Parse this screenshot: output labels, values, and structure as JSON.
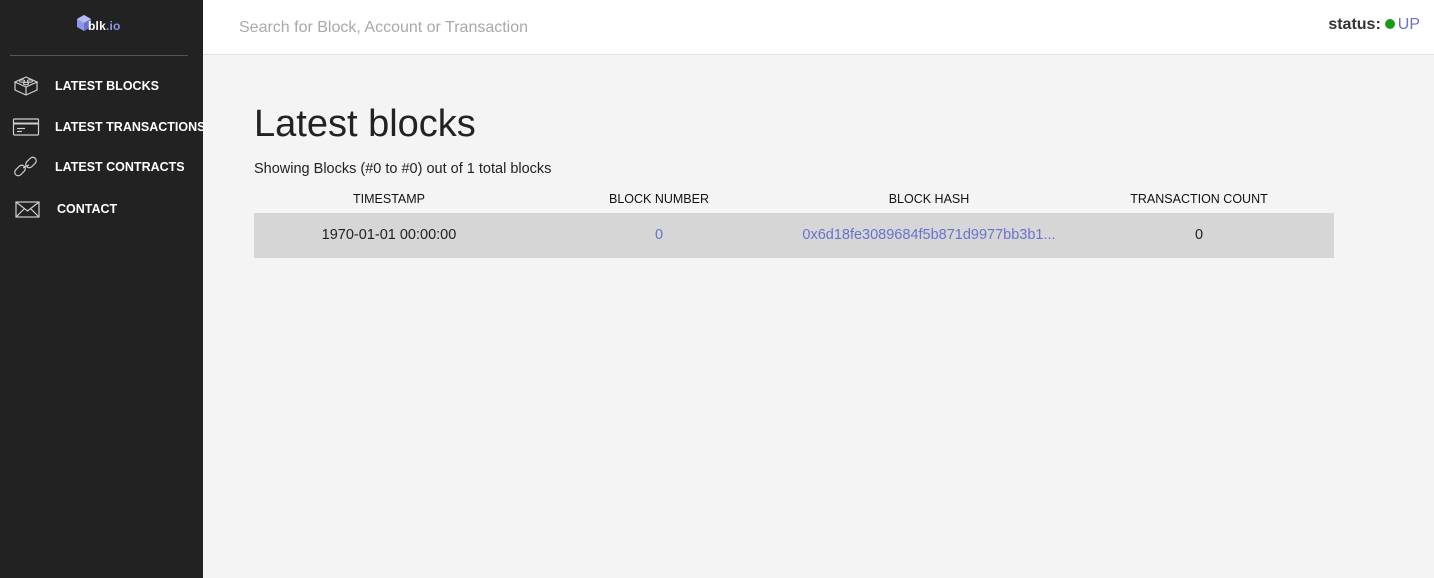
{
  "app": {
    "logo_prefix": "blk",
    "logo_suffix": ".io"
  },
  "sidebar": {
    "items": [
      {
        "label": "LATEST BLOCKS",
        "icon": "blocks-icon"
      },
      {
        "label": "LATEST TRANSACTIONS",
        "icon": "card-icon"
      },
      {
        "label": "LATEST CONTRACTS",
        "icon": "link-icon"
      },
      {
        "label": "CONTACT",
        "icon": "envelope-icon"
      }
    ]
  },
  "header": {
    "search_placeholder": "Search for Block, Account or Transaction",
    "status_label": "status:",
    "status_value": "UP"
  },
  "main": {
    "title": "Latest blocks",
    "showing_text": "Showing Blocks (#0 to #0) out of 1 total blocks",
    "columns": [
      "TIMESTAMP",
      "BLOCK NUMBER",
      "BLOCK HASH",
      "TRANSACTION COUNT"
    ],
    "rows": [
      {
        "timestamp": "1970-01-01 00:00:00",
        "block_number": "0",
        "block_hash": "0x6d18fe3089684f5b871d9977bb3b1...",
        "transaction_count": "0"
      }
    ]
  },
  "colors": {
    "sidebar_bg": "#222222",
    "accent": "#6a72cc",
    "status_up": "#1a9a1a",
    "row_bg": "#d6d6d6"
  }
}
